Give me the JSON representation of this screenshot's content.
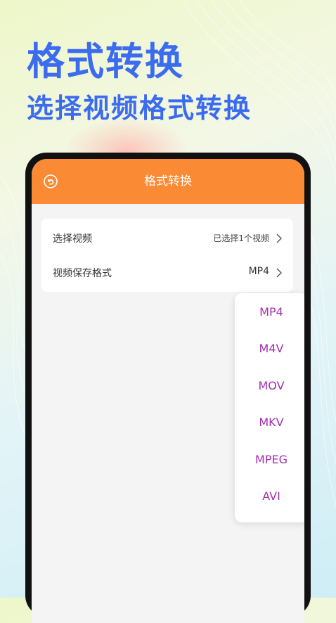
{
  "promo": {
    "headline": "格式转换",
    "subheadline": "选择视频格式转换"
  },
  "app": {
    "title": "格式转换",
    "back_icon": "back-circle-icon",
    "accent_color": "#fb8a34",
    "option_color": "#a32fb0"
  },
  "settings": {
    "select_video": {
      "label": "选择视频",
      "value": "已选择1个视频"
    },
    "save_format": {
      "label": "视频保存格式",
      "value": "MP4"
    }
  },
  "format_options": [
    "MP4",
    "M4V",
    "MOV",
    "MKV",
    "MPEG",
    "AVI"
  ]
}
